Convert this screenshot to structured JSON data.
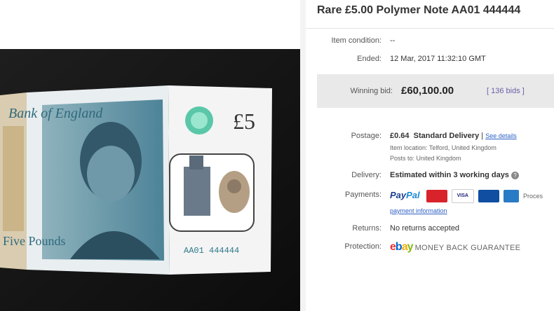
{
  "listing": {
    "title": "Rare £5.00 Polymer Note AA01 444444",
    "item_condition_label": "Item condition:",
    "item_condition_value": "--",
    "ended_label": "Ended:",
    "ended_value": "12 Mar, 2017  11:32:10 GMT",
    "winning_bid_label": "Winning bid:",
    "winning_bid_value": "£60,100.00",
    "bids_count": "[ 136 bids ]",
    "postage_label": "Postage:",
    "postage_price": "£0.64",
    "postage_method": "Standard Delivery",
    "postage_sep": "|",
    "see_details": "See details",
    "item_location": "Item location:  Telford, United Kingdom",
    "posts_to": "Posts to:  United Kingdom",
    "delivery_label": "Delivery:",
    "delivery_value": "Estimated within 3 working days",
    "payments_label": "Payments:",
    "paypal_pay": "Pay",
    "paypal_pal": "Pal",
    "payment_information": "payment information",
    "processed_by": "Processed by PayPal",
    "returns_label": "Returns:",
    "returns_value": "No returns accepted",
    "protection_label": "Protection:",
    "ebay_e": "e",
    "ebay_b": "b",
    "ebay_a": "a",
    "ebay_y": "y",
    "money_back": "MONEY BACK GUARANTEE",
    "card_visa": "VISA"
  },
  "note": {
    "denomination": "£5",
    "bank_text": "Bank of England",
    "serial": "AA01 444444",
    "five": "Five Pounds"
  },
  "colors": {
    "accent_link": "#2f60c4",
    "bids_color": "#6b5ea8",
    "note_teal": "#5c8fa3",
    "ebay_red": "#e53238",
    "ebay_blue": "#0064d2",
    "ebay_yellow": "#f5af02",
    "ebay_green": "#86b817"
  }
}
